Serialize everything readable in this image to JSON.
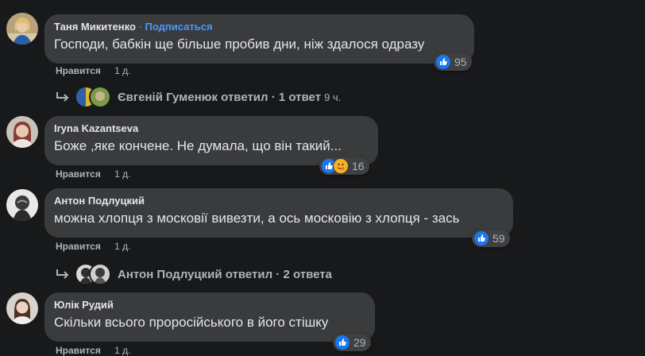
{
  "comments": [
    {
      "author": "Таня Микитенко",
      "separator": "·",
      "follow_label": "Подписаться",
      "text": "Господи, бабкін ще більше пробив дни, ніж здалося одразу",
      "reaction_count": "95",
      "like_label": "Нравится",
      "time": "1 д.",
      "avatar_icon": "avatar-photo-woman-blonde"
    },
    {
      "author": "Iryna Kazantseva",
      "text": "Боже ,яке кончене. Не думала, що він такий...",
      "reaction_count": "16",
      "like_label": "Нравится",
      "time": "1 д.",
      "avatar_icon": "avatar-photo-woman"
    },
    {
      "author": "Антон Подлуцкий",
      "text": "можна хлопця з московії вивезти, а ось московію з хлопця - зась",
      "reaction_count": "59",
      "like_label": "Нравится",
      "time": "1 д.",
      "avatar_icon": "avatar-photo-bw"
    },
    {
      "author": "Юлік Рудий",
      "text": "Скільки всього проросійського в його стішку",
      "reaction_count": "29",
      "like_label": "Нравится",
      "time": "1 д.",
      "avatar_icon": "avatar-photo-woman"
    }
  ],
  "replies": [
    {
      "text": "Євгеній Гуменюк ответил · 1 ответ",
      "time": "9 ч."
    },
    {
      "text": "Антон Подлуцкий ответил · 2 ответа",
      "time": ""
    }
  ],
  "colors": {
    "background": "#18191a",
    "bubble": "#3a3b3c",
    "link": "#4599ff",
    "like": "#1877f2",
    "haha": "#f7b125"
  }
}
